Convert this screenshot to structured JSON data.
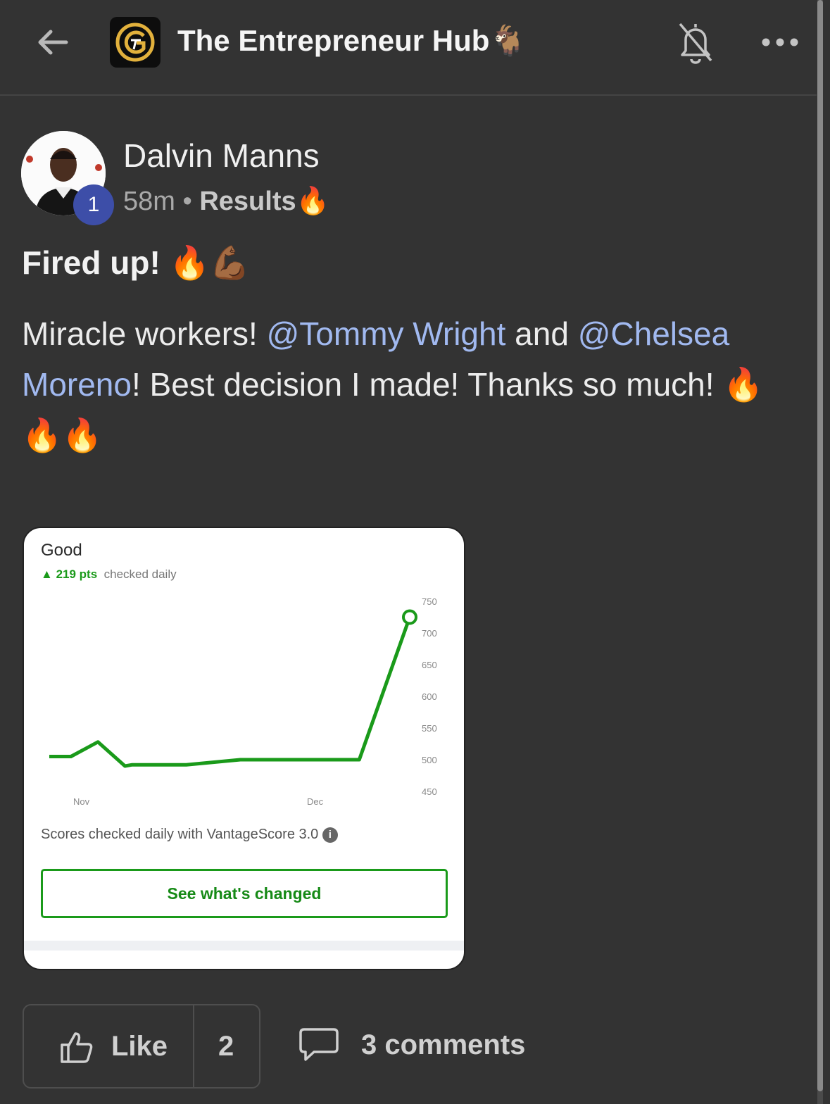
{
  "header": {
    "group_title": "The Entrepreneur Hub🐐"
  },
  "post": {
    "author": "Dalvin Manns",
    "level_badge": "1",
    "time": "58m",
    "separator": " • ",
    "category": "Results🔥",
    "title": "Fired up! 🔥💪🏾",
    "body": [
      {
        "text": "Miracle workers! ",
        "mention": false
      },
      {
        "text": "@Tommy Wright",
        "mention": true
      },
      {
        "text": " and ",
        "mention": false
      },
      {
        "text": "@Chelsea Moreno",
        "mention": true
      },
      {
        "text": "! Best decision I made! Thanks so much! 🔥🔥🔥",
        "mention": false
      }
    ]
  },
  "attachment": {
    "heading": "Good",
    "pts_change": "219 pts",
    "pts_note": "checked daily",
    "footnote": "Scores checked daily with VantageScore 3.0",
    "button_label": "See what's changed",
    "colors": {
      "line": "#1a9a1a"
    }
  },
  "chart_data": {
    "type": "line",
    "x_tick_labels": [
      "Nov",
      "Dec"
    ],
    "y_ticks": [
      750,
      700,
      650,
      600,
      550,
      500,
      450
    ],
    "ylim": [
      450,
      750
    ],
    "series": [
      {
        "values": [
          505,
          505,
          528,
          490,
          492,
          492,
          500,
          500,
          500,
          500,
          725
        ]
      }
    ]
  },
  "actions": {
    "like_label": "Like",
    "like_count": "2",
    "comments_label": "3 comments"
  }
}
